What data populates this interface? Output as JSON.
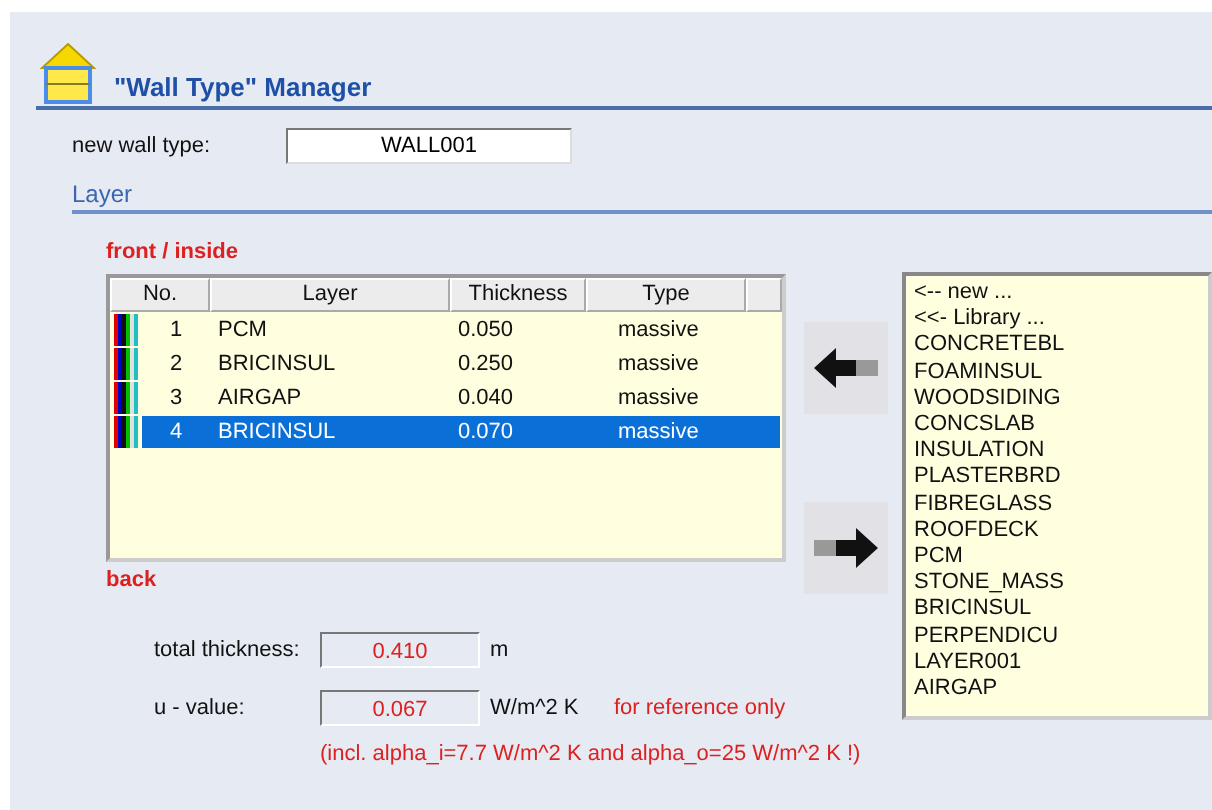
{
  "title": "\"Wall Type\" Manager",
  "new_wall_type": {
    "label": "new wall type:",
    "value": "WALL001"
  },
  "section": "Layer",
  "front_label": "front / inside",
  "back_label": "back",
  "table": {
    "columns": [
      "No.",
      "Layer",
      "Thickness",
      "Type"
    ],
    "rows": [
      {
        "no": "1",
        "layer": "PCM",
        "thickness": "0.050",
        "type": "massive",
        "selected": false
      },
      {
        "no": "2",
        "layer": "BRICINSUL",
        "thickness": "0.250",
        "type": "massive",
        "selected": false
      },
      {
        "no": "3",
        "layer": "AIRGAP",
        "thickness": "0.040",
        "type": "massive",
        "selected": false
      },
      {
        "no": "4",
        "layer": "BRICINSUL",
        "thickness": "0.070",
        "type": "massive",
        "selected": true
      }
    ]
  },
  "library": [
    "<-- new ...",
    "<<- Library ...",
    "CONCRETEBL",
    "FOAMINSUL",
    "WOODSIDING",
    "CONCSLAB",
    "INSULATION",
    "PLASTERBRD",
    "FIBREGLASS",
    "ROOFDECK",
    "PCM",
    "STONE_MASS",
    "BRICINSUL",
    "PERPENDICU",
    "LAYER001",
    "AIRGAP"
  ],
  "results": [
    {
      "label": "total thickness:",
      "value": "0.410",
      "unit": "m"
    },
    {
      "label": "u - value:",
      "value": "0.067",
      "unit": "W/m^2 K",
      "note": "for reference only"
    }
  ],
  "footnote": "(incl. alpha_i=7.7 W/m^2 K and alpha_o=25 W/m^2 K !)"
}
